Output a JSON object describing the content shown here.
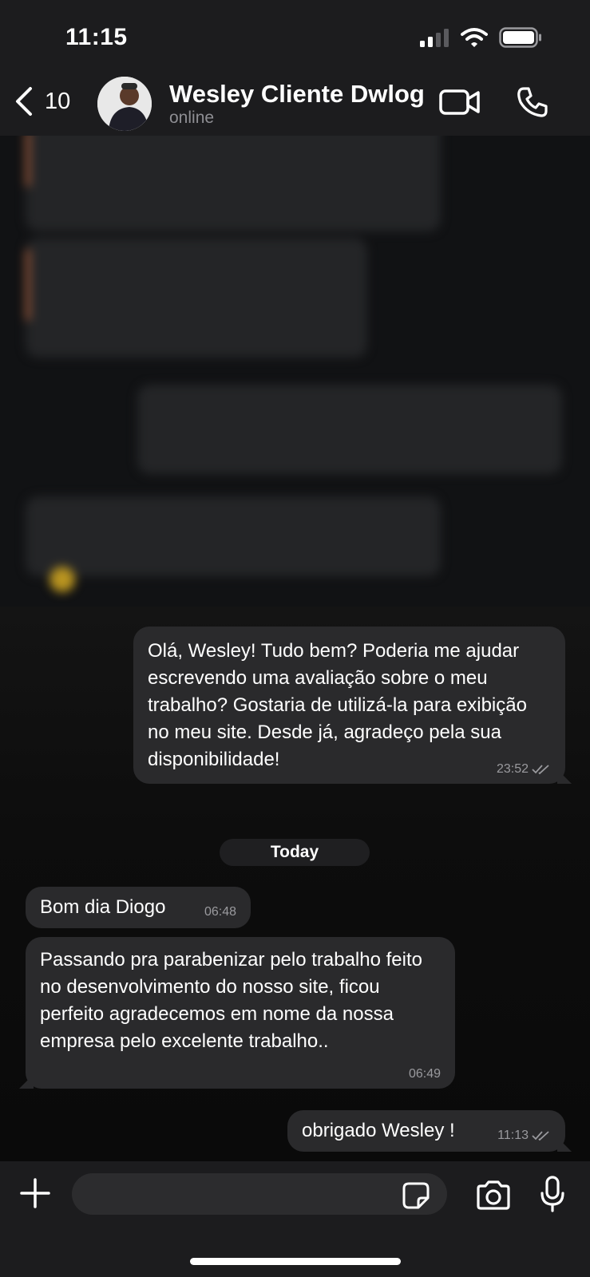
{
  "status_bar": {
    "time": "11:15"
  },
  "header": {
    "back_count": "10",
    "contact_name": "Wesley Cliente Dwlog",
    "contact_status": "online"
  },
  "messages": [
    {
      "direction": "out",
      "text": "Olá, Wesley! Tudo bem? Poderia me ajudar escrevendo uma avaliação sobre o meu trabalho? Gostaria de utilizá-la para exibição no meu site. Desde já, agradeço pela sua disponibilidade!",
      "time": "23:52"
    },
    {
      "direction": "in",
      "text": "Bom dia Diogo",
      "time": "06:48"
    },
    {
      "direction": "in",
      "text": "Passando pra parabenizar  pelo trabalho feito no desenvolvimento do nosso site, ficou perfeito agradecemos em nome da nossa empresa pelo excelente trabalho..",
      "time": "06:49"
    },
    {
      "direction": "out",
      "text": "obrigado Wesley !",
      "time": "11:13"
    }
  ],
  "day_separator": "Today",
  "composer": {
    "placeholder": ""
  },
  "colors": {
    "bubble": "#2a2a2c",
    "background": "#0b0b0b",
    "header": "#1c1c1e",
    "meta_text": "#9a9a9e"
  },
  "icons": [
    "back-chevron-icon",
    "video-call-icon",
    "phone-icon",
    "plus-icon",
    "sticker-icon",
    "camera-icon",
    "microphone-icon",
    "double-check-icon",
    "signal-icon",
    "wifi-icon",
    "battery-icon"
  ]
}
